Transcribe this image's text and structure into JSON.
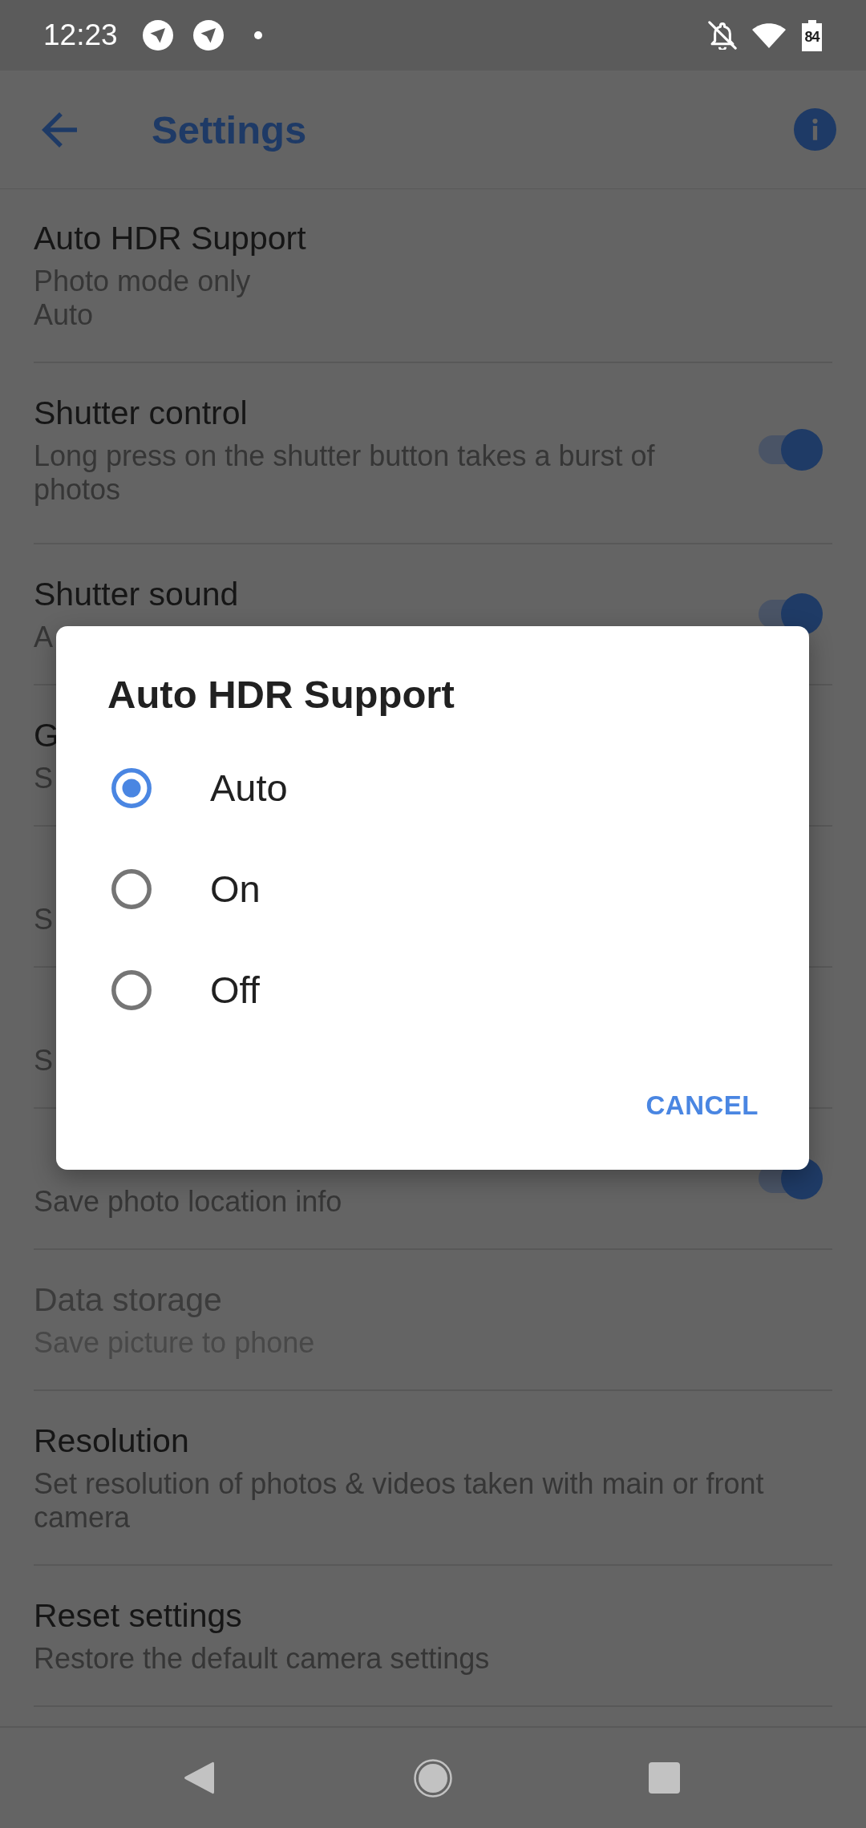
{
  "status_bar": {
    "time": "12:23",
    "battery": "84"
  },
  "app_bar": {
    "title": "Settings"
  },
  "settings": [
    {
      "kind": "text",
      "title": "Auto HDR Support",
      "summary": [
        "Photo mode only",
        "Auto"
      ],
      "disabled": false
    },
    {
      "kind": "switch",
      "title": "Shutter control",
      "summary": [
        "Long press on the shutter button takes a burst of photos"
      ],
      "on": true,
      "disabled": false
    },
    {
      "kind": "switch",
      "title": "Shutter sound",
      "summary": [
        "A"
      ],
      "on": true,
      "disabled": false
    },
    {
      "kind": "text",
      "title": "G",
      "summary": [
        "S"
      ],
      "disabled": false
    },
    {
      "kind": "text",
      "summary": [
        "S"
      ],
      "disabled": false
    },
    {
      "kind": "text",
      "summary": [
        "S"
      ],
      "disabled": false
    },
    {
      "kind": "switch",
      "summary": [
        "Save photo location info"
      ],
      "on": true,
      "disabled": false
    },
    {
      "kind": "text",
      "title": "Data storage",
      "summary": [
        "Save picture to phone"
      ],
      "disabled": true
    },
    {
      "kind": "text",
      "title": "Resolution",
      "summary": [
        "Set resolution of photos & videos taken with main or front camera"
      ],
      "disabled": false
    },
    {
      "kind": "text",
      "title": "Reset settings",
      "summary": [
        "Restore the default camera settings"
      ],
      "disabled": false
    }
  ],
  "dialog": {
    "title": "Auto HDR Support",
    "options": [
      {
        "label": "Auto",
        "selected": true
      },
      {
        "label": "On",
        "selected": false
      },
      {
        "label": "Off",
        "selected": false
      }
    ],
    "button": "CANCEL"
  }
}
